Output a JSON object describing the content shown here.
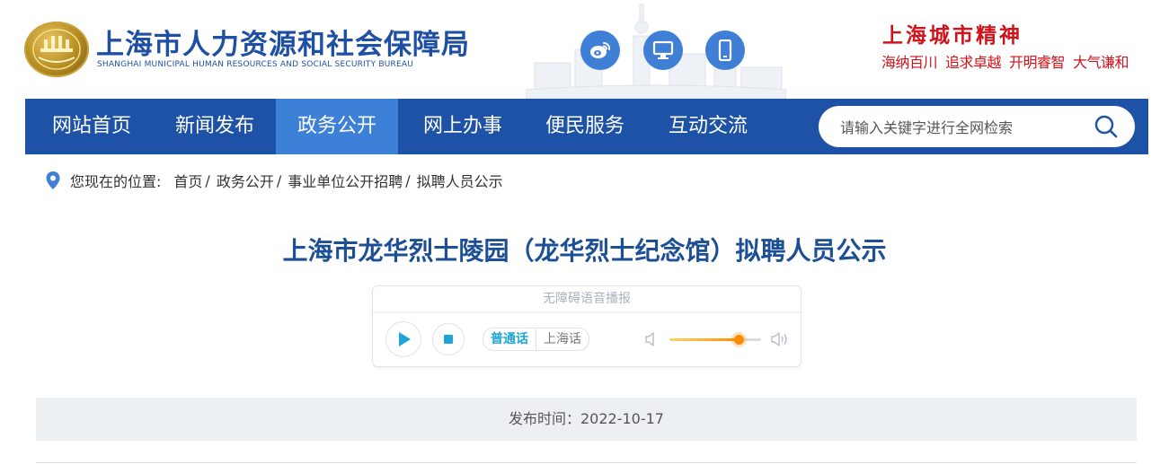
{
  "header": {
    "title": "上海市人力资源和社会保障局",
    "subtitle": "SHANGHAI MUNICIPAL HUMAN RESOURCES AND SOCIAL SECURITY BUREAU",
    "social": [
      {
        "icon": "weibo-icon"
      },
      {
        "icon": "desktop-icon"
      },
      {
        "icon": "mobile-icon"
      }
    ],
    "slogan": {
      "title": "上海城市精神",
      "phrases": [
        "海纳百川",
        "追求卓越",
        "开明睿智",
        "大气谦和"
      ]
    }
  },
  "nav": {
    "items": [
      {
        "label": "网站首页",
        "active": false
      },
      {
        "label": "新闻发布",
        "active": false
      },
      {
        "label": "政务公开",
        "active": true
      },
      {
        "label": "网上办事",
        "active": false
      },
      {
        "label": "便民服务",
        "active": false
      },
      {
        "label": "互动交流",
        "active": false
      }
    ],
    "search_placeholder": "请输入关键字进行全网检索"
  },
  "breadcrumb": {
    "prefix": "您现在的位置:",
    "items": [
      "首页",
      "政务公开",
      "事业单位公开招聘",
      "拟聘人员公示"
    ]
  },
  "article": {
    "title": "上海市龙华烈士陵园（龙华烈士纪念馆）拟聘人员公示",
    "publish": "发布时间：2022-10-17"
  },
  "player": {
    "header": "无障碍语音播报",
    "languages": [
      "普通话",
      "上海话"
    ],
    "selected_language": "普通话",
    "volume": 0.75
  },
  "colors": {
    "nav_bg": "#1d52a6",
    "nav_active": "#3d80d8",
    "title_blue": "#1d4f96",
    "slogan_red": "#d0121b"
  }
}
